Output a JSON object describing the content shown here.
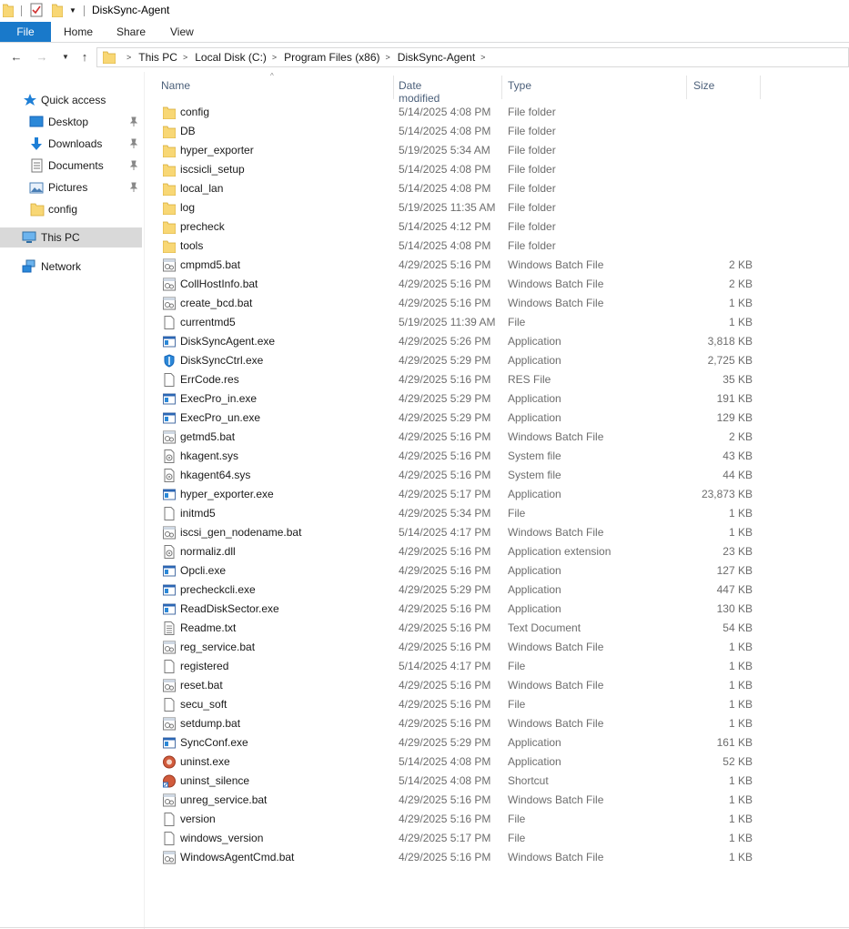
{
  "window": {
    "title": "DiskSync-Agent"
  },
  "ribbon": {
    "tabs": [
      "File",
      "Home",
      "Share",
      "View"
    ]
  },
  "address": {
    "crumbs": [
      "This PC",
      "Local Disk (C:)",
      "Program Files (x86)",
      "DiskSync-Agent"
    ]
  },
  "nav": {
    "items": [
      {
        "label": "Quick access",
        "icon": "star-icon",
        "pinned": false
      },
      {
        "label": "Desktop",
        "icon": "desktop-icon",
        "pinned": true
      },
      {
        "label": "Downloads",
        "icon": "download-arrow-icon",
        "pinned": true
      },
      {
        "label": "Documents",
        "icon": "documents-icon",
        "pinned": true
      },
      {
        "label": "Pictures",
        "icon": "pictures-icon",
        "pinned": true
      },
      {
        "label": "config",
        "icon": "folder-icon",
        "pinned": false
      },
      {
        "label": "This PC",
        "icon": "computer-icon",
        "pinned": false
      },
      {
        "label": "Network",
        "icon": "network-icon",
        "pinned": false
      }
    ]
  },
  "columns": {
    "name": "Name",
    "date": "Date modified",
    "type": "Type",
    "size": "Size"
  },
  "files": [
    {
      "name": "config",
      "date": "5/14/2025 4:08 PM",
      "type": "File folder",
      "size": "",
      "icon": "folder"
    },
    {
      "name": "DB",
      "date": "5/14/2025 4:08 PM",
      "type": "File folder",
      "size": "",
      "icon": "folder"
    },
    {
      "name": "hyper_exporter",
      "date": "5/19/2025 5:34 AM",
      "type": "File folder",
      "size": "",
      "icon": "folder"
    },
    {
      "name": "iscsicli_setup",
      "date": "5/14/2025 4:08 PM",
      "type": "File folder",
      "size": "",
      "icon": "folder"
    },
    {
      "name": "local_lan",
      "date": "5/14/2025 4:08 PM",
      "type": "File folder",
      "size": "",
      "icon": "folder"
    },
    {
      "name": "log",
      "date": "5/19/2025 11:35 AM",
      "type": "File folder",
      "size": "",
      "icon": "folder"
    },
    {
      "name": "precheck",
      "date": "5/14/2025 4:12 PM",
      "type": "File folder",
      "size": "",
      "icon": "folder"
    },
    {
      "name": "tools",
      "date": "5/14/2025 4:08 PM",
      "type": "File folder",
      "size": "",
      "icon": "folder"
    },
    {
      "name": "cmpmd5.bat",
      "date": "4/29/2025 5:16 PM",
      "type": "Windows Batch File",
      "size": "2 KB",
      "icon": "bat"
    },
    {
      "name": "CollHostInfo.bat",
      "date": "4/29/2025 5:16 PM",
      "type": "Windows Batch File",
      "size": "2 KB",
      "icon": "bat"
    },
    {
      "name": "create_bcd.bat",
      "date": "4/29/2025 5:16 PM",
      "type": "Windows Batch File",
      "size": "1 KB",
      "icon": "bat"
    },
    {
      "name": "currentmd5",
      "date": "5/19/2025 11:39 AM",
      "type": "File",
      "size": "1 KB",
      "icon": "file"
    },
    {
      "name": "DiskSyncAgent.exe",
      "date": "4/29/2025 5:26 PM",
      "type": "Application",
      "size": "3,818 KB",
      "icon": "exe"
    },
    {
      "name": "DiskSyncCtrl.exe",
      "date": "4/29/2025 5:29 PM",
      "type": "Application",
      "size": "2,725 KB",
      "icon": "shield-exe"
    },
    {
      "name": "ErrCode.res",
      "date": "4/29/2025 5:16 PM",
      "type": "RES File",
      "size": "35 KB",
      "icon": "file"
    },
    {
      "name": "ExecPro_in.exe",
      "date": "4/29/2025 5:29 PM",
      "type": "Application",
      "size": "191 KB",
      "icon": "exe"
    },
    {
      "name": "ExecPro_un.exe",
      "date": "4/29/2025 5:29 PM",
      "type": "Application",
      "size": "129 KB",
      "icon": "exe"
    },
    {
      "name": "getmd5.bat",
      "date": "4/29/2025 5:16 PM",
      "type": "Windows Batch File",
      "size": "2 KB",
      "icon": "bat"
    },
    {
      "name": "hkagent.sys",
      "date": "4/29/2025 5:16 PM",
      "type": "System file",
      "size": "43 KB",
      "icon": "sys"
    },
    {
      "name": "hkagent64.sys",
      "date": "4/29/2025 5:16 PM",
      "type": "System file",
      "size": "44 KB",
      "icon": "sys"
    },
    {
      "name": "hyper_exporter.exe",
      "date": "4/29/2025 5:17 PM",
      "type": "Application",
      "size": "23,873 KB",
      "icon": "exe"
    },
    {
      "name": "initmd5",
      "date": "4/29/2025 5:34 PM",
      "type": "File",
      "size": "1 KB",
      "icon": "file"
    },
    {
      "name": "iscsi_gen_nodename.bat",
      "date": "5/14/2025 4:17 PM",
      "type": "Windows Batch File",
      "size": "1 KB",
      "icon": "bat"
    },
    {
      "name": "normaliz.dll",
      "date": "4/29/2025 5:16 PM",
      "type": "Application extension",
      "size": "23 KB",
      "icon": "sys"
    },
    {
      "name": "Opcli.exe",
      "date": "4/29/2025 5:16 PM",
      "type": "Application",
      "size": "127 KB",
      "icon": "exe"
    },
    {
      "name": "precheckcli.exe",
      "date": "4/29/2025 5:29 PM",
      "type": "Application",
      "size": "447 KB",
      "icon": "exe"
    },
    {
      "name": "ReadDiskSector.exe",
      "date": "4/29/2025 5:16 PM",
      "type": "Application",
      "size": "130 KB",
      "icon": "exe"
    },
    {
      "name": "Readme.txt",
      "date": "4/29/2025 5:16 PM",
      "type": "Text Document",
      "size": "54 KB",
      "icon": "txt"
    },
    {
      "name": "reg_service.bat",
      "date": "4/29/2025 5:16 PM",
      "type": "Windows Batch File",
      "size": "1 KB",
      "icon": "bat"
    },
    {
      "name": "registered",
      "date": "5/14/2025 4:17 PM",
      "type": "File",
      "size": "1 KB",
      "icon": "file"
    },
    {
      "name": "reset.bat",
      "date": "4/29/2025 5:16 PM",
      "type": "Windows Batch File",
      "size": "1 KB",
      "icon": "bat"
    },
    {
      "name": "secu_soft",
      "date": "4/29/2025 5:16 PM",
      "type": "File",
      "size": "1 KB",
      "icon": "file"
    },
    {
      "name": "setdump.bat",
      "date": "4/29/2025 5:16 PM",
      "type": "Windows Batch File",
      "size": "1 KB",
      "icon": "bat"
    },
    {
      "name": "SyncConf.exe",
      "date": "4/29/2025 5:29 PM",
      "type": "Application",
      "size": "161 KB",
      "icon": "exe"
    },
    {
      "name": "uninst.exe",
      "date": "5/14/2025 4:08 PM",
      "type": "Application",
      "size": "52 KB",
      "icon": "uninstaller"
    },
    {
      "name": "uninst_silence",
      "date": "5/14/2025 4:08 PM",
      "type": "Shortcut",
      "size": "1 KB",
      "icon": "shortcut"
    },
    {
      "name": "unreg_service.bat",
      "date": "4/29/2025 5:16 PM",
      "type": "Windows Batch File",
      "size": "1 KB",
      "icon": "bat"
    },
    {
      "name": "version",
      "date": "4/29/2025 5:16 PM",
      "type": "File",
      "size": "1 KB",
      "icon": "file"
    },
    {
      "name": "windows_version",
      "date": "4/29/2025 5:17 PM",
      "type": "File",
      "size": "1 KB",
      "icon": "file"
    },
    {
      "name": "WindowsAgentCmd.bat",
      "date": "4/29/2025 5:16 PM",
      "type": "Windows Batch File",
      "size": "1 KB",
      "icon": "bat"
    }
  ],
  "colors": {
    "file_tab": "#1979ca",
    "folder": "#f8d775",
    "selected_nav": "#d9d9d9",
    "header_text": "#4c607a"
  }
}
